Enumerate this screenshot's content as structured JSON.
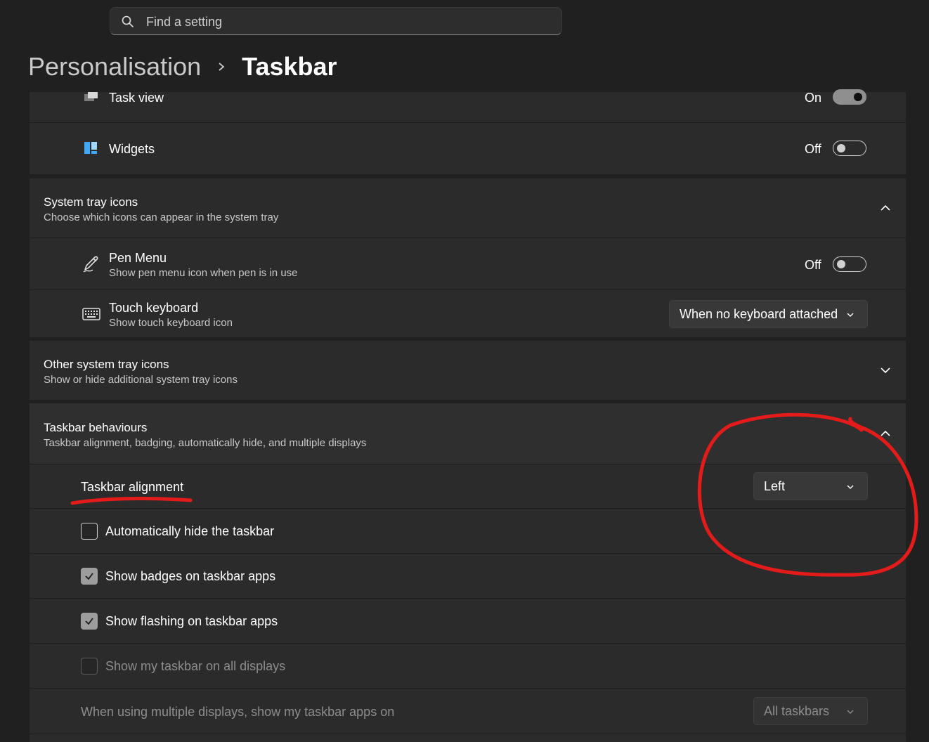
{
  "search": {
    "placeholder": "Find a setting"
  },
  "breadcrumb": {
    "parent": "Personalisation",
    "current": "Taskbar"
  },
  "taskbar_items": [
    {
      "label": "Task view",
      "state": "On",
      "on": true
    },
    {
      "label": "Widgets",
      "state": "Off",
      "on": false
    }
  ],
  "system_tray": {
    "title": "System tray icons",
    "subtitle": "Choose which icons can appear in the system tray",
    "expanded": true,
    "pen_menu": {
      "label": "Pen Menu",
      "subtitle": "Show pen menu icon when pen is in use",
      "state": "Off",
      "on": false
    },
    "touch_keyboard": {
      "label": "Touch keyboard",
      "subtitle": "Show touch keyboard icon",
      "value": "When no keyboard attached"
    }
  },
  "other_tray": {
    "title": "Other system tray icons",
    "subtitle": "Show or hide additional system tray icons",
    "expanded": false
  },
  "behaviours": {
    "title": "Taskbar behaviours",
    "subtitle": "Taskbar alignment, badging, automatically hide, and multiple displays",
    "expanded": true,
    "alignment": {
      "label": "Taskbar alignment",
      "value": "Left"
    },
    "checkboxes": [
      {
        "label": "Automatically hide the taskbar",
        "checked": false,
        "disabled": false
      },
      {
        "label": "Show badges on taskbar apps",
        "checked": true,
        "disabled": false
      },
      {
        "label": "Show flashing on taskbar apps",
        "checked": true,
        "disabled": false
      },
      {
        "label": "Show my taskbar on all displays",
        "checked": false,
        "disabled": true
      }
    ],
    "multi_display": {
      "label": "When using multiple displays, show my taskbar apps on",
      "value": "All taskbars"
    }
  },
  "colors": {
    "background": "#202020",
    "card": "#2b2b2b",
    "annotation": "#e31b1b"
  }
}
